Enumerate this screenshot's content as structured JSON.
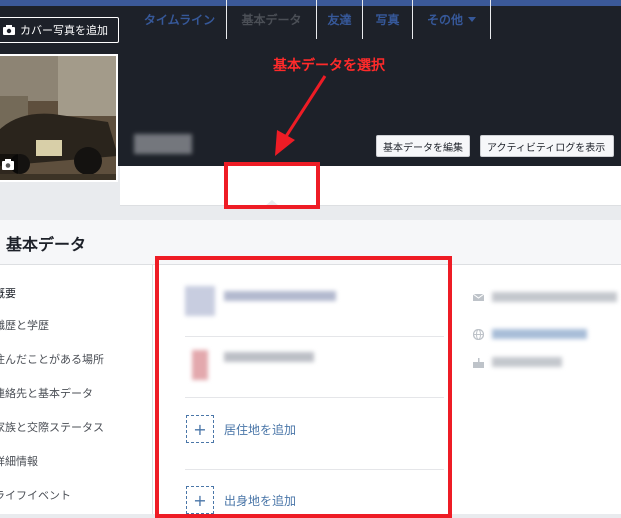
{
  "cover": {
    "add_cover_label": "カバー写真を追加"
  },
  "annotation": {
    "text": "基本データを選択"
  },
  "header_buttons": {
    "edit_about": "基本データを編集",
    "view_activity_log": "アクティビティログを表示"
  },
  "tabs": [
    "タイムライン",
    "基本データ",
    "友達",
    "写真",
    "その他"
  ],
  "about": {
    "title": "基本データ",
    "sidebar": [
      "概要",
      "職歴と学歴",
      "住んだことがある場所",
      "連絡先と基本データ",
      "家族と交際ステータス",
      "詳細情報",
      "ライフイベント"
    ],
    "add_residence": "居住地を追加",
    "add_hometown": "出身地を追加",
    "plus": "+"
  },
  "colors": {
    "annotation_red": "#ee1c25",
    "link_blue": "#365899",
    "cover_dark": "#1d2129"
  }
}
